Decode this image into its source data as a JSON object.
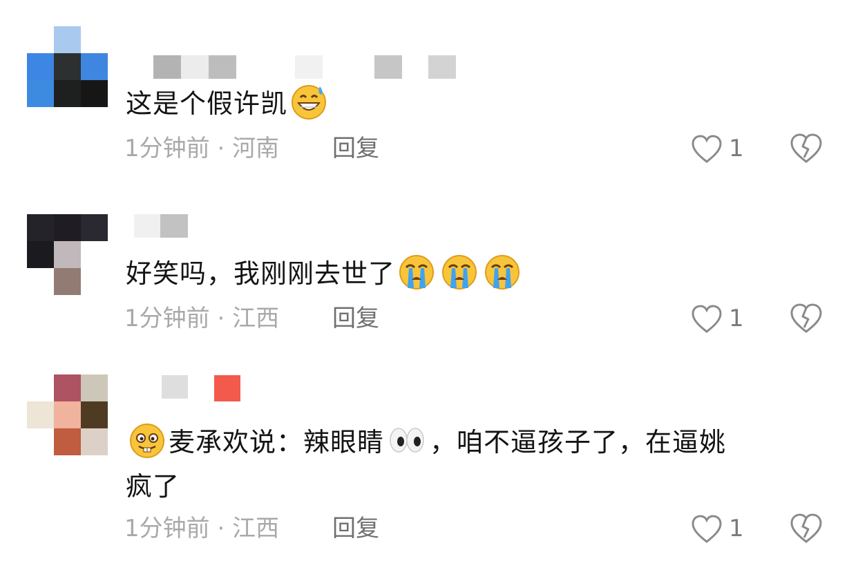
{
  "comments": [
    {
      "text": "这是个假许凯",
      "emoji": "grinning-sweat",
      "time": "1分钟前",
      "separator": "·",
      "location": "河南",
      "reply_label": "回复",
      "like_count": "1"
    },
    {
      "text": "好笑吗，我刚刚去世了",
      "emoji": "loudly-crying",
      "time": "1分钟前",
      "separator": "·",
      "location": "江西",
      "reply_label": "回复",
      "like_count": "1"
    },
    {
      "text_a": "麦承欢说：辣眼睛",
      "text_b": "，咱不逼孩子了，在逼姚",
      "text_c": "疯了",
      "emoji": "buck-teeth-face",
      "time": "1分钟前",
      "separator": "·",
      "location": "江西",
      "reply_label": "回复",
      "like_count": "1"
    }
  ],
  "icons": {
    "like": "heart-outline-icon",
    "dislike": "broken-heart-icon"
  },
  "colors": {
    "text": "#141414",
    "meta": "#a9a9a9",
    "reply": "#6f6f6f",
    "icon": "#8a8a8a"
  }
}
